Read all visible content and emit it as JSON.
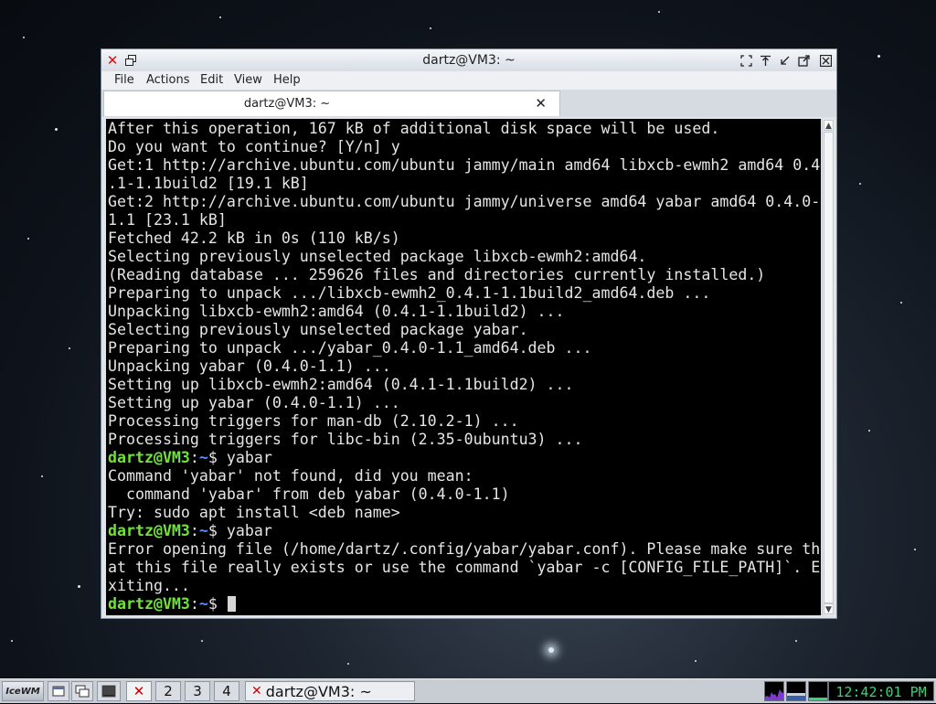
{
  "window": {
    "title": "dartz@VM3: ~"
  },
  "menubar": {
    "items": [
      "File",
      "Actions",
      "Edit",
      "View",
      "Help"
    ]
  },
  "tab": {
    "label": "dartz@VM3: ~"
  },
  "terminal": {
    "lines": [
      {
        "text": "After this operation, 167 kB of additional disk space will be used."
      },
      {
        "text": "Do you want to continue? [Y/n] y"
      },
      {
        "text": "Get:1 http://archive.ubuntu.com/ubuntu jammy/main amd64 libxcb-ewmh2 amd64 0.4"
      },
      {
        "text": ".1-1.1build2 [19.1 kB]"
      },
      {
        "text": "Get:2 http://archive.ubuntu.com/ubuntu jammy/universe amd64 yabar amd64 0.4.0-"
      },
      {
        "text": "1.1 [23.1 kB]"
      },
      {
        "text": "Fetched 42.2 kB in 0s (110 kB/s)"
      },
      {
        "text": "Selecting previously unselected package libxcb-ewmh2:amd64."
      },
      {
        "text": "(Reading database ... 259626 files and directories currently installed.)"
      },
      {
        "text": "Preparing to unpack .../libxcb-ewmh2_0.4.1-1.1build2_amd64.deb ..."
      },
      {
        "text": "Unpacking libxcb-ewmh2:amd64 (0.4.1-1.1build2) ..."
      },
      {
        "text": "Selecting previously unselected package yabar."
      },
      {
        "text": "Preparing to unpack .../yabar_0.4.0-1.1_amd64.deb ..."
      },
      {
        "text": "Unpacking yabar (0.4.0-1.1) ..."
      },
      {
        "text": "Setting up libxcb-ewmh2:amd64 (0.4.1-1.1build2) ..."
      },
      {
        "text": "Setting up yabar (0.4.0-1.1) ..."
      },
      {
        "text": "Processing triggers for man-db (2.10.2-1) ..."
      },
      {
        "text": "Processing triggers for libc-bin (2.35-0ubuntu3) ..."
      },
      {
        "user": "dartz@VM3",
        "sep": ":",
        "path": "~",
        "cmd": "$ yabar"
      },
      {
        "text": "Command 'yabar' not found, did you mean:"
      },
      {
        "text": "  command 'yabar' from deb yabar (0.4.0-1.1)"
      },
      {
        "text": "Try: sudo apt install <deb name>"
      },
      {
        "user": "dartz@VM3",
        "sep": ":",
        "path": "~",
        "cmd": "$ yabar"
      },
      {
        "text": "Error opening file (/home/dartz/.config/yabar/yabar.conf). Please make sure th"
      },
      {
        "text": "at this file really exists or use the command `yabar -c [CONFIG_FILE_PATH]`. E"
      },
      {
        "text": "xiting..."
      },
      {
        "user": "dartz@VM3",
        "sep": ":",
        "path": "~",
        "cmd": "$ ",
        "cursor": true
      }
    ]
  },
  "taskbar": {
    "start_label": "IceWM",
    "workspaces": [
      "2",
      "3",
      "4"
    ],
    "task_label": "dartz@VM3: ~",
    "clock": "12:42:01 PM"
  },
  "colors": {
    "prompt_user": "#6fe33a",
    "prompt_path": "#5c8cff",
    "terminal_bg": "#000000",
    "terminal_fg": "#e5e5e5",
    "clock_fg": "#3fd07a"
  },
  "icons": {
    "window_menu": "close-x-icon",
    "restore": "restore-icon",
    "titlebar_right": [
      "fullscreen-icon",
      "raise-icon",
      "minimize-icon",
      "maximize-icon",
      "close-icon"
    ],
    "tab_close": "tab-close-icon",
    "taskbar": [
      "show-desktop-icon",
      "terminal-icon",
      "window-list-icon"
    ]
  }
}
